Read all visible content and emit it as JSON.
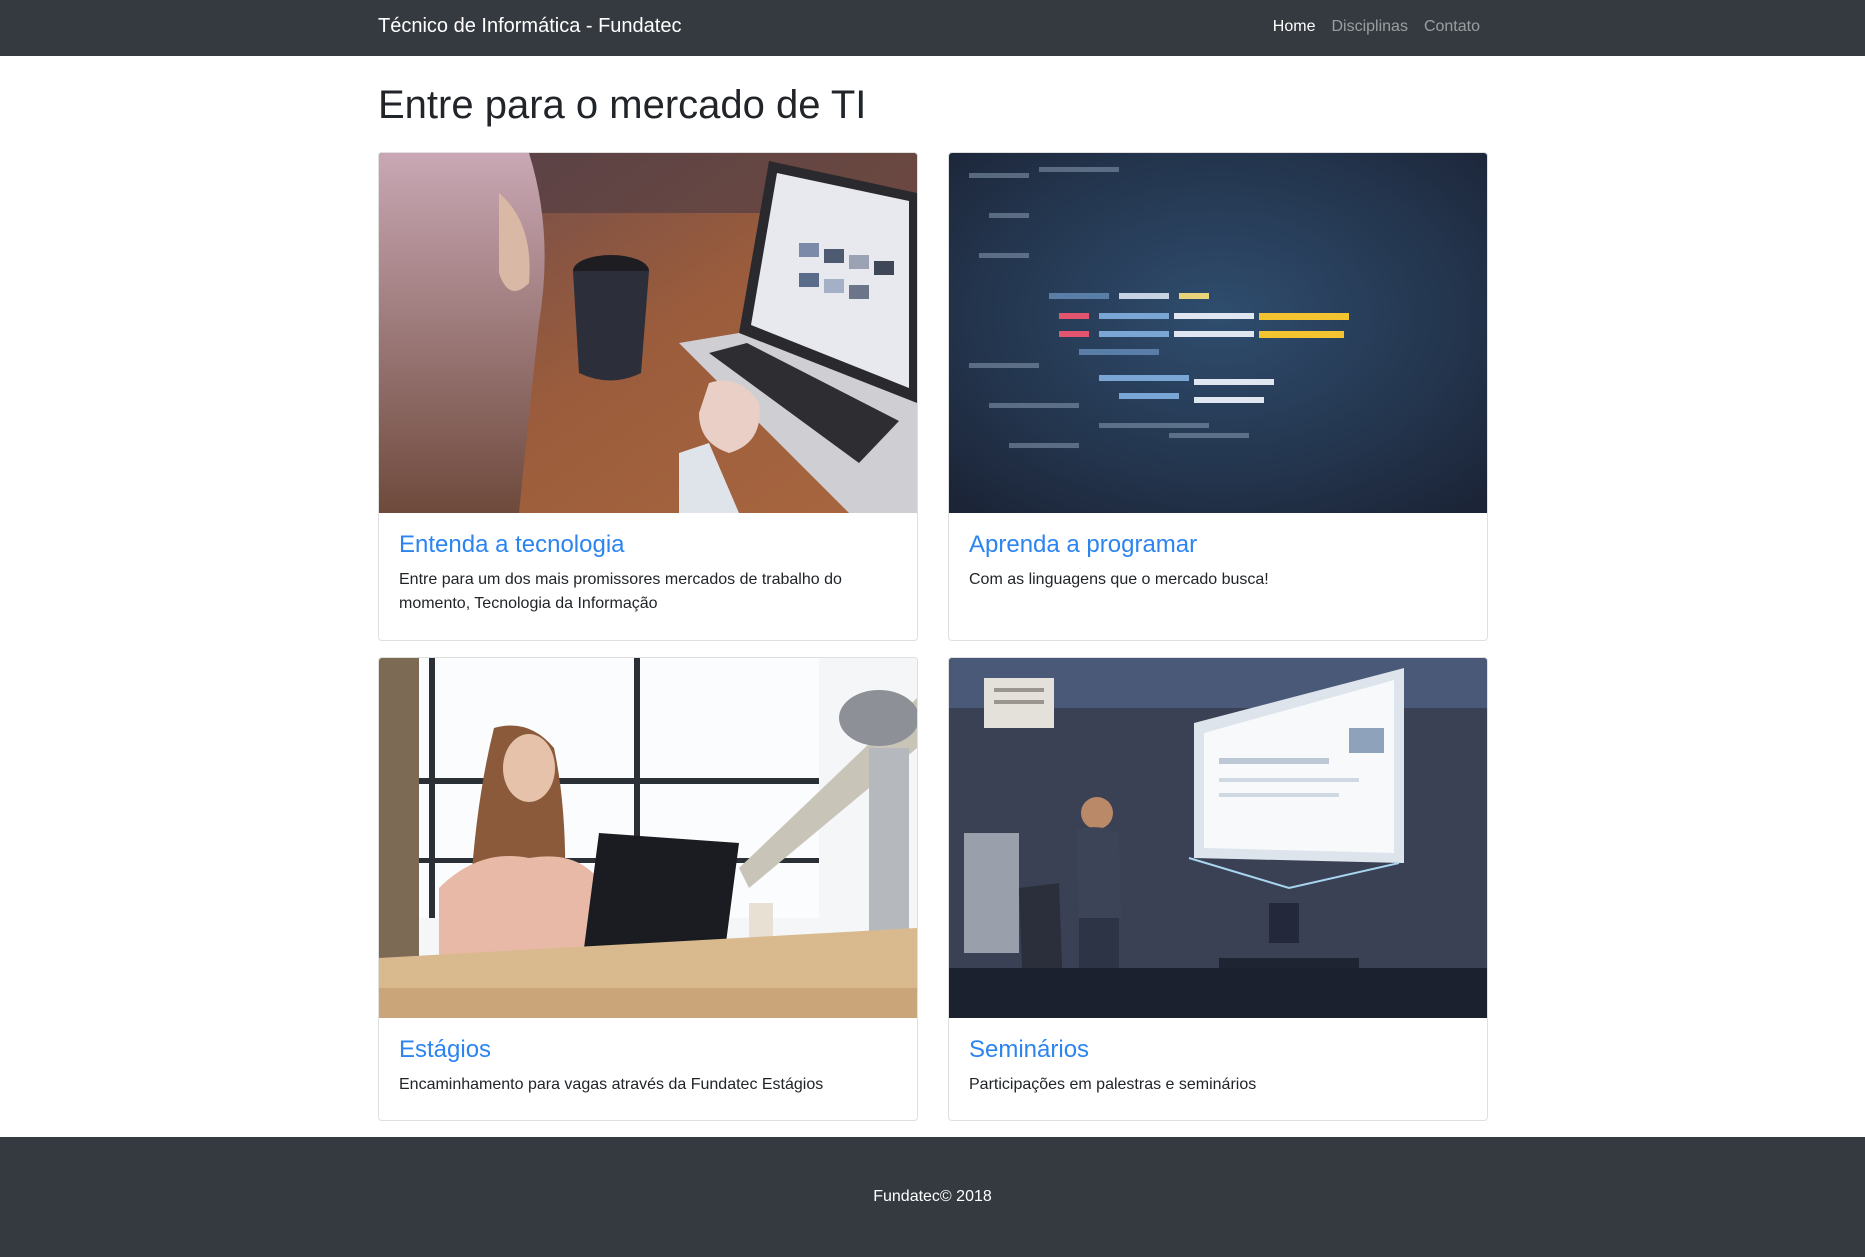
{
  "navbar": {
    "brand": "Técnico de Informática - Fundatec",
    "links": [
      {
        "label": "Home",
        "active": true
      },
      {
        "label": "Disciplinas",
        "active": false
      },
      {
        "label": "Contato",
        "active": false
      }
    ]
  },
  "main": {
    "title": "Entre para o mercado de TI",
    "cards": [
      {
        "title": "Entenda a tecnologia",
        "text": "Entre para um dos mais promissores mercados de trabalho do momento, Tecnologia da Informação"
      },
      {
        "title": "Aprenda a programar",
        "text": "Com as linguagens que o mercado busca!"
      },
      {
        "title": "Estágios",
        "text": "Encaminhamento para vagas através da Fundatec Estágios"
      },
      {
        "title": "Seminários",
        "text": "Participações em palestras e seminários"
      }
    ]
  },
  "footer": {
    "text": "Fundatec© 2018"
  },
  "colors": {
    "navbar_bg": "#343a40",
    "link_blue": "#2b84f0"
  }
}
